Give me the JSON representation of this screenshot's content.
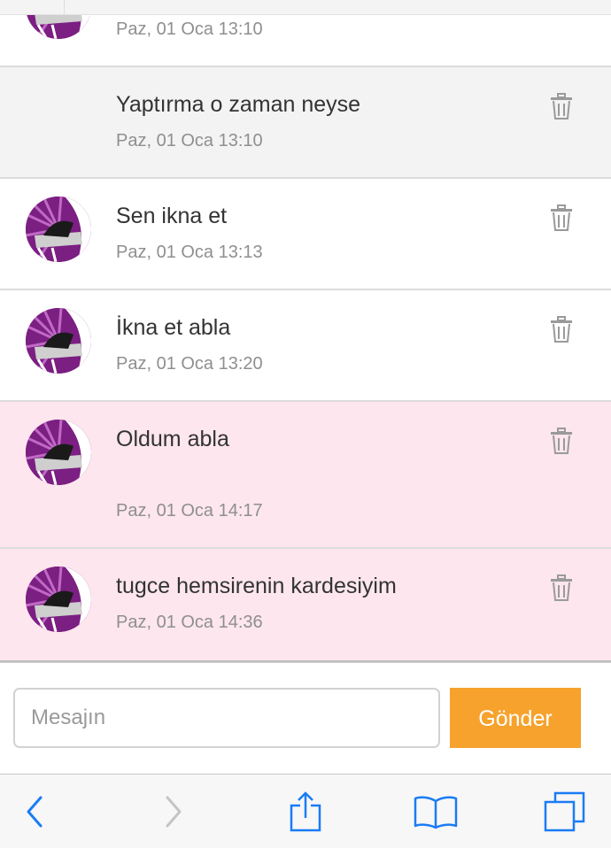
{
  "messages": [
    {
      "text": "",
      "time": "Paz, 01 Oca 13:10",
      "highlight": "white",
      "has_avatar": true
    },
    {
      "text": "Yaptırma o zaman neyse",
      "time": "Paz, 01 Oca 13:10",
      "highlight": "gray",
      "has_avatar": false
    },
    {
      "text": "Sen ikna et",
      "time": "Paz, 01 Oca 13:13",
      "highlight": "white",
      "has_avatar": true
    },
    {
      "text": "İkna et abla",
      "time": "Paz, 01 Oca 13:20",
      "highlight": "white",
      "has_avatar": true
    },
    {
      "text": "Oldum abla",
      "time": "Paz, 01 Oca 14:17",
      "highlight": "pink",
      "has_avatar": true
    },
    {
      "text": "tugce hemsirenin kardesiyim",
      "time": "Paz, 01 Oca 14:36",
      "highlight": "pink",
      "has_avatar": true
    }
  ],
  "composer": {
    "placeholder": "Mesajın",
    "send_label": "Gönder"
  },
  "toolbar": {
    "items": [
      "chevron-left-icon",
      "chevron-right-icon",
      "share-icon",
      "bookmarks-icon",
      "tabs-icon"
    ]
  },
  "colors": {
    "accent": "#f6a22d",
    "highlight_pink": "#fde6ee",
    "row_gray": "#f3f3f3",
    "toolbar_icon": "#1a7cf5"
  }
}
